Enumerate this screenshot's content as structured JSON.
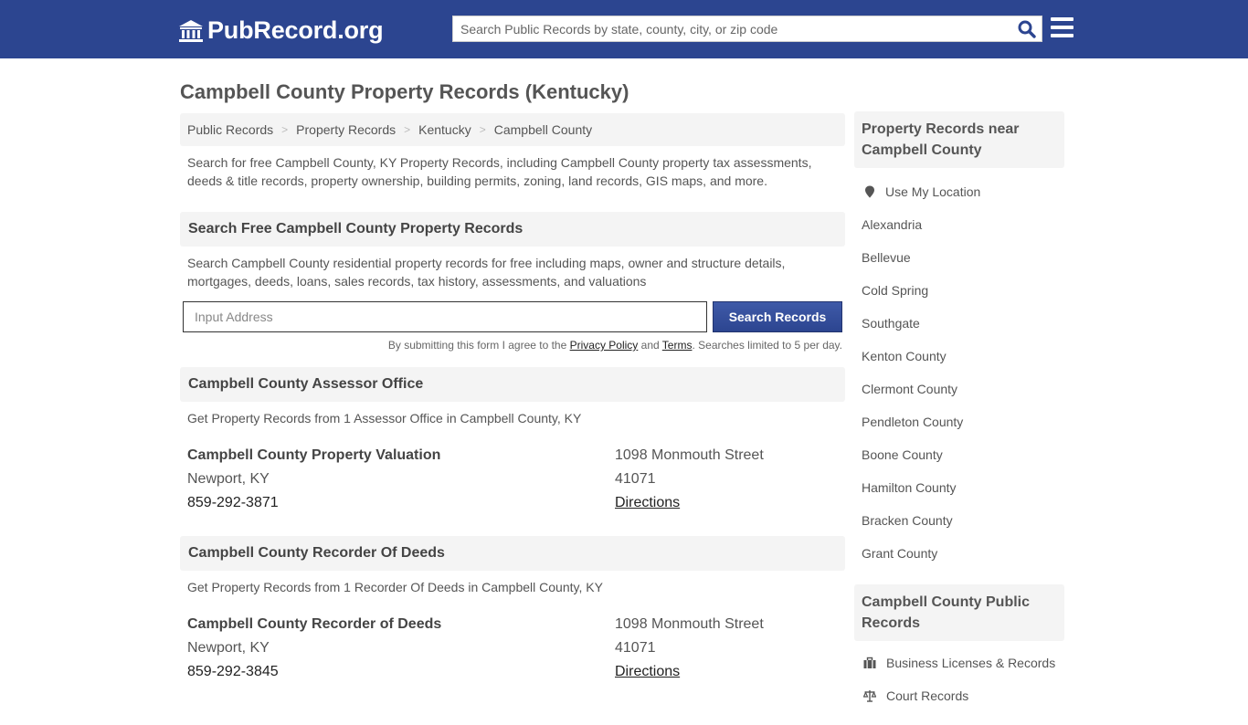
{
  "header": {
    "logo_text": "PubRecord.org",
    "search_placeholder": "Search Public Records by state, county, city, or zip code",
    "colors": {
      "brand": "#2c4590",
      "search_icon": "#2c4590"
    }
  },
  "page_title": "Campbell County Property Records (Kentucky)",
  "breadcrumb": [
    "Public Records",
    "Property Records",
    "Kentucky",
    "Campbell County"
  ],
  "intro": "Search for free Campbell County, KY Property Records, including Campbell County property tax assessments, deeds & title records, property ownership, building permits, zoning, land records, GIS maps, and more.",
  "search_section": {
    "title": "Search Free Campbell County Property Records",
    "description": "Search Campbell County residential property records for free including maps, owner and structure details, mortgages, deeds, loans, sales records, tax history, assessments, and valuations",
    "input_placeholder": "Input Address",
    "button_label": "Search Records",
    "disclaimer_prefix": "By submitting this form I agree to the ",
    "privacy_label": "Privacy Policy",
    "disclaimer_and": " and ",
    "terms_label": "Terms",
    "disclaimer_suffix": ". Searches limited to 5 per day."
  },
  "offices": [
    {
      "section_title": "Campbell County Assessor Office",
      "section_text": "Get Property Records from 1 Assessor Office in Campbell County, KY",
      "name": "Campbell County Property Valuation",
      "city": "Newport, KY",
      "phone": "859-292-3871",
      "street": "1098 Monmouth Street",
      "zip": "41071",
      "directions_label": "Directions"
    },
    {
      "section_title": "Campbell County Recorder Of Deeds",
      "section_text": "Get Property Records from 1 Recorder Of Deeds in Campbell County, KY",
      "name": "Campbell County Recorder of Deeds",
      "city": "Newport, KY",
      "phone": "859-292-3845",
      "street": "1098 Monmouth Street",
      "zip": "41071",
      "directions_label": "Directions"
    }
  ],
  "sidebar": {
    "nearby_title": "Property Records near Campbell County",
    "use_location": "Use My Location",
    "nearby": [
      "Alexandria",
      "Bellevue",
      "Cold Spring",
      "Southgate",
      "Kenton County",
      "Clermont County",
      "Pendleton County",
      "Boone County",
      "Hamilton County",
      "Bracken County",
      "Grant County"
    ],
    "public_title": "Campbell County Public Records",
    "public_items": [
      {
        "icon": "briefcase-icon",
        "label": "Business Licenses & Records"
      },
      {
        "icon": "scales-icon",
        "label": "Court Records"
      }
    ]
  }
}
